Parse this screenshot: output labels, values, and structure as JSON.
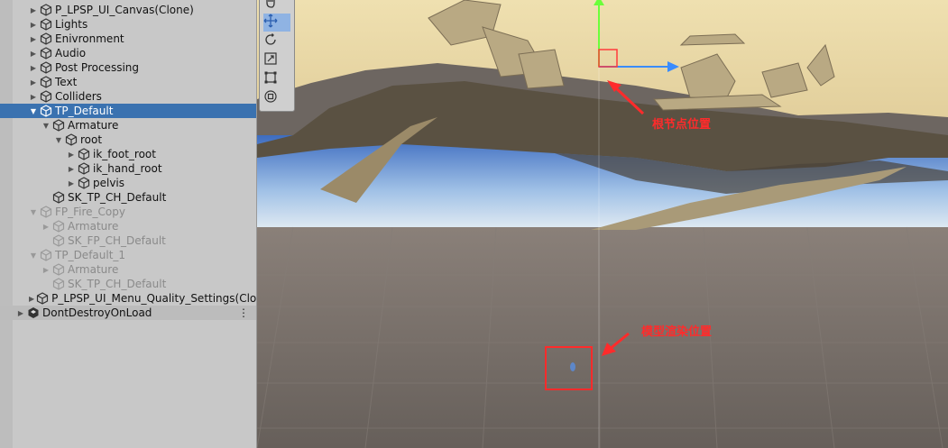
{
  "hierarchy": {
    "items": [
      {
        "label": "P_LPSP_UI_Canvas(Clone)",
        "depth": 1,
        "expand": "closed",
        "state": "normal"
      },
      {
        "label": "Lights",
        "depth": 1,
        "expand": "closed",
        "state": "normal"
      },
      {
        "label": "Enivronment",
        "depth": 1,
        "expand": "closed",
        "state": "normal"
      },
      {
        "label": "Audio",
        "depth": 1,
        "expand": "closed",
        "state": "normal"
      },
      {
        "label": "Post Processing",
        "depth": 1,
        "expand": "closed",
        "state": "normal"
      },
      {
        "label": "Text",
        "depth": 1,
        "expand": "closed",
        "state": "normal"
      },
      {
        "label": "Colliders",
        "depth": 1,
        "expand": "closed",
        "state": "normal"
      },
      {
        "label": "TP_Default",
        "depth": 1,
        "expand": "open",
        "state": "selected"
      },
      {
        "label": "Armature",
        "depth": 2,
        "expand": "open",
        "state": "normal"
      },
      {
        "label": "root",
        "depth": 3,
        "expand": "open",
        "state": "normal"
      },
      {
        "label": "ik_foot_root",
        "depth": 4,
        "expand": "closed",
        "state": "normal"
      },
      {
        "label": "ik_hand_root",
        "depth": 4,
        "expand": "closed",
        "state": "normal"
      },
      {
        "label": "pelvis",
        "depth": 4,
        "expand": "closed",
        "state": "normal"
      },
      {
        "label": "SK_TP_CH_Default",
        "depth": 2,
        "expand": "none",
        "state": "normal"
      },
      {
        "label": "FP_Fire_Copy",
        "depth": 1,
        "expand": "open",
        "state": "disabled"
      },
      {
        "label": "Armature",
        "depth": 2,
        "expand": "closed",
        "state": "disabled"
      },
      {
        "label": "SK_FP_CH_Default",
        "depth": 2,
        "expand": "none",
        "state": "disabled"
      },
      {
        "label": "TP_Default_1",
        "depth": 1,
        "expand": "open",
        "state": "disabled"
      },
      {
        "label": "Armature",
        "depth": 2,
        "expand": "closed",
        "state": "disabled"
      },
      {
        "label": "SK_TP_CH_Default",
        "depth": 2,
        "expand": "none",
        "state": "disabled"
      },
      {
        "label": "P_LPSP_UI_Menu_Quality_Settings(Clone)",
        "depth": 1,
        "expand": "closed",
        "state": "normal"
      },
      {
        "label": "DontDestroyOnLoad",
        "depth": 0,
        "expand": "closed",
        "state": "scene"
      }
    ],
    "more_menu": "⋮"
  },
  "toolbar": {
    "tools": [
      {
        "name": "hand-tool",
        "icon": "hand-icon",
        "active": false
      },
      {
        "name": "move-tool",
        "icon": "move-icon",
        "active": true
      },
      {
        "name": "rotate-tool",
        "icon": "rotate-icon",
        "active": false
      },
      {
        "name": "scale-tool",
        "icon": "scale-icon",
        "active": false
      },
      {
        "name": "rect-tool",
        "icon": "rect-icon",
        "active": false
      },
      {
        "name": "transform-tool",
        "icon": "transform-icon",
        "active": false
      }
    ]
  },
  "annotations": {
    "root_node": "根节点位置",
    "model_render": "模型渲染位置"
  },
  "colors": {
    "selected_row": "#3a72b0",
    "annotation": "#ff2b2b",
    "gizmo_y": "#6bff3a",
    "gizmo_x": "#3a8cff"
  }
}
